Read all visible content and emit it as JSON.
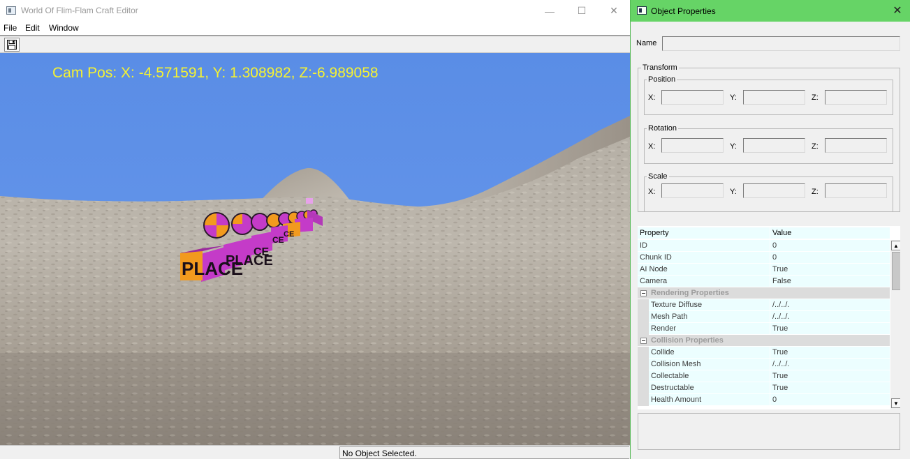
{
  "editor": {
    "title": "World Of Flim-Flam Craft Editor",
    "menu": [
      "File",
      "Edit",
      "Window"
    ],
    "caption": {
      "minimize": "—",
      "maximize": "☐",
      "close": "✕"
    },
    "toolbar": {
      "save_icon": "floppy-disk-icon"
    },
    "viewport": {
      "cam_pos": "Cam Pos: X: -4.571591, Y: 1.308982, Z:-6.989058",
      "cube_labels": [
        "PLACE",
        "PLACE",
        "CE",
        "CE",
        "CE"
      ],
      "colors": {
        "sky": "#5b8fe8",
        "cam_text": "#f5f232",
        "cube_magenta": "#c23ac8",
        "cube_orange": "#f29a1e"
      }
    },
    "status": "No Object Selected."
  },
  "properties": {
    "title": "Object Properties",
    "close": "✕",
    "name_label": "Name",
    "name_value": "",
    "transform": {
      "title": "Transform",
      "groups": [
        {
          "title": "Position",
          "x": "X:",
          "y": "Y:",
          "z": "Z:"
        },
        {
          "title": "Rotation",
          "x": "X:",
          "y": "Y:",
          "z": "Z:"
        },
        {
          "title": "Scale",
          "x": "X:",
          "y": "Y:",
          "z": "Z:"
        }
      ]
    },
    "grid": {
      "header": {
        "name": "Property",
        "value": "Value"
      },
      "rows": [
        {
          "name": "ID",
          "value": "0"
        },
        {
          "name": "Chunk ID",
          "value": "0"
        },
        {
          "name": "AI Node",
          "value": "True"
        },
        {
          "name": "Camera",
          "value": "False"
        }
      ],
      "rendering": {
        "title": "Rendering Properties",
        "rows": [
          {
            "name": "Texture Diffuse",
            "value": "/../../."
          },
          {
            "name": "Mesh Path",
            "value": "/../../."
          },
          {
            "name": "Render",
            "value": "True"
          }
        ]
      },
      "collision": {
        "title": "Collision Properties",
        "rows": [
          {
            "name": "Collide",
            "value": "True"
          },
          {
            "name": "Collision Mesh",
            "value": "/../../."
          },
          {
            "name": "Collectable",
            "value": "True"
          },
          {
            "name": "Destructable",
            "value": "True"
          },
          {
            "name": "Health Amount",
            "value": "0"
          }
        ]
      },
      "scroll": {
        "up": "▲",
        "down": "▼"
      }
    }
  }
}
